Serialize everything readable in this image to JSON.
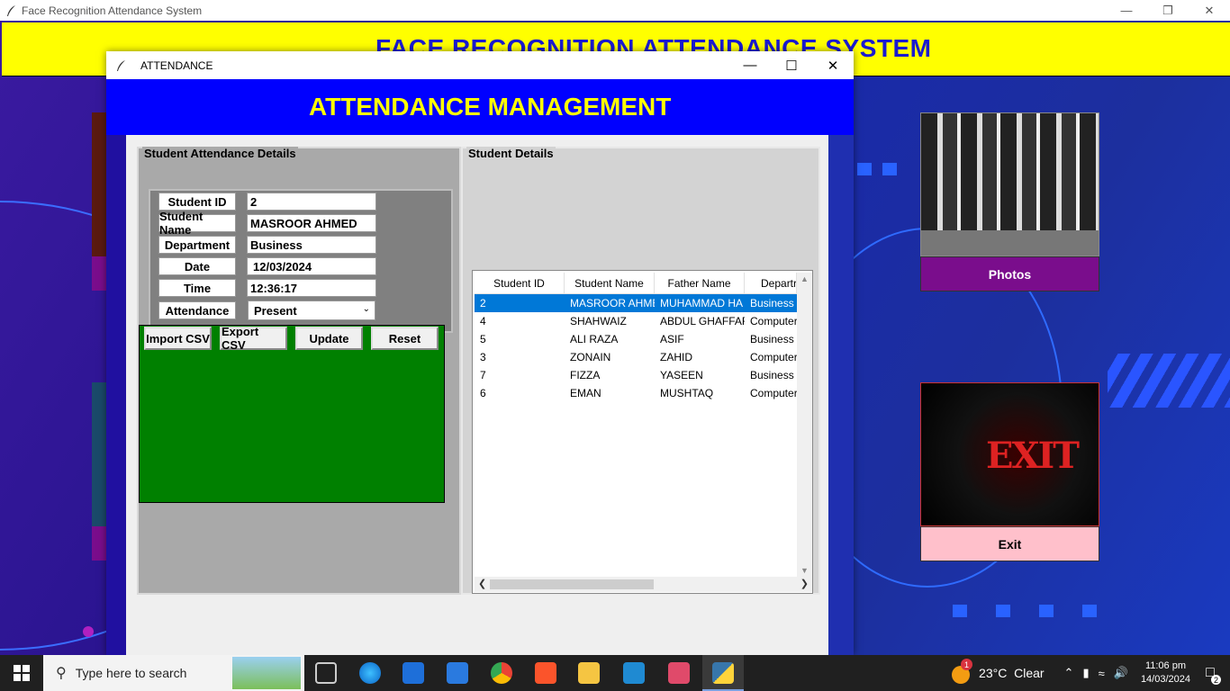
{
  "main_window": {
    "title": "Face Recognition Attendance System",
    "header": "FACE RECOGNITION ATTENDANCE SYSTEM",
    "photos_label": "Photos",
    "exit_label": "Exit"
  },
  "dialog": {
    "title": "ATTENDANCE",
    "header": "ATTENDANCE MANAGEMENT",
    "left_frame_title": "Student Attendance Details",
    "right_frame_title": "Student Details",
    "form": {
      "student_id_label": "Student ID",
      "student_id_value": "2",
      "student_name_label": "Student Name",
      "student_name_value": "MASROOR AHMED",
      "department_label": "Department",
      "department_value": "Business",
      "date_label": "Date",
      "date_value": "12/03/2024",
      "time_label": "Time",
      "time_value": "12:36:17",
      "attendance_label": "Attendance",
      "attendance_value": "Present"
    },
    "buttons": {
      "import": "Import CSV",
      "export": "Export CSV",
      "update": "Update",
      "reset": "Reset"
    },
    "table": {
      "columns": [
        "Student ID",
        "Student Name",
        "Father Name",
        "Departr"
      ],
      "rows": [
        [
          "2",
          "MASROOR AHME",
          "MUHAMMAD HA",
          "Business"
        ],
        [
          "4",
          "SHAHWAIZ",
          "ABDUL GHAFFAR",
          "Computer"
        ],
        [
          "5",
          "ALI RAZA",
          "ASIF",
          "Business"
        ],
        [
          "3",
          "ZONAIN",
          "ZAHID",
          "Computer"
        ],
        [
          "7",
          "FIZZA",
          "YASEEN",
          "Business"
        ],
        [
          "6",
          "EMAN",
          "MUSHTAQ",
          "Computer"
        ]
      ],
      "selected_row": 0
    }
  },
  "taskbar": {
    "search_placeholder": "Type here to search",
    "weather": "23°C  Clear",
    "weather_badge": "1",
    "time": "11:06 pm",
    "date": "14/03/2024",
    "notifications": "2"
  },
  "colors": {
    "main_header_bg": "#ffff00",
    "dialog_header_bg": "#0000ff",
    "dialog_header_text": "#ffff00",
    "button_area_bg": "#008000",
    "photos_btn_bg": "#7a0d8c",
    "exit_btn_bg": "#ffc0cb",
    "selection": "#0078d7"
  }
}
